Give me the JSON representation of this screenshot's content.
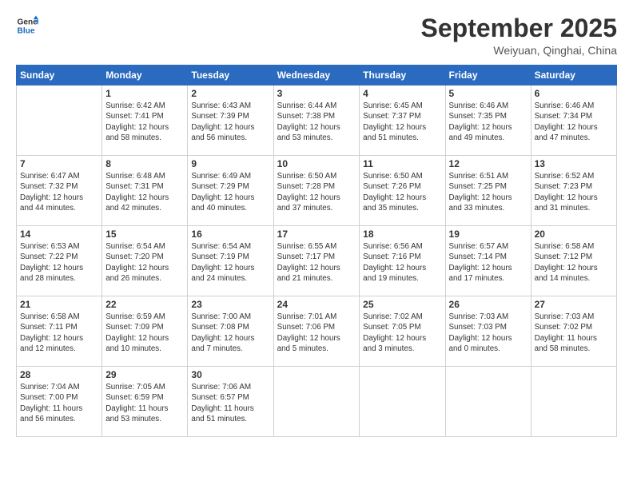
{
  "logo": {
    "line1": "General",
    "line2": "Blue"
  },
  "title": "September 2025",
  "location": "Weiyuan, Qinghai, China",
  "days_of_week": [
    "Sunday",
    "Monday",
    "Tuesday",
    "Wednesday",
    "Thursday",
    "Friday",
    "Saturday"
  ],
  "weeks": [
    [
      {
        "day": "",
        "info": ""
      },
      {
        "day": "1",
        "info": "Sunrise: 6:42 AM\nSunset: 7:41 PM\nDaylight: 12 hours\nand 58 minutes."
      },
      {
        "day": "2",
        "info": "Sunrise: 6:43 AM\nSunset: 7:39 PM\nDaylight: 12 hours\nand 56 minutes."
      },
      {
        "day": "3",
        "info": "Sunrise: 6:44 AM\nSunset: 7:38 PM\nDaylight: 12 hours\nand 53 minutes."
      },
      {
        "day": "4",
        "info": "Sunrise: 6:45 AM\nSunset: 7:37 PM\nDaylight: 12 hours\nand 51 minutes."
      },
      {
        "day": "5",
        "info": "Sunrise: 6:46 AM\nSunset: 7:35 PM\nDaylight: 12 hours\nand 49 minutes."
      },
      {
        "day": "6",
        "info": "Sunrise: 6:46 AM\nSunset: 7:34 PM\nDaylight: 12 hours\nand 47 minutes."
      }
    ],
    [
      {
        "day": "7",
        "info": "Sunrise: 6:47 AM\nSunset: 7:32 PM\nDaylight: 12 hours\nand 44 minutes."
      },
      {
        "day": "8",
        "info": "Sunrise: 6:48 AM\nSunset: 7:31 PM\nDaylight: 12 hours\nand 42 minutes."
      },
      {
        "day": "9",
        "info": "Sunrise: 6:49 AM\nSunset: 7:29 PM\nDaylight: 12 hours\nand 40 minutes."
      },
      {
        "day": "10",
        "info": "Sunrise: 6:50 AM\nSunset: 7:28 PM\nDaylight: 12 hours\nand 37 minutes."
      },
      {
        "day": "11",
        "info": "Sunrise: 6:50 AM\nSunset: 7:26 PM\nDaylight: 12 hours\nand 35 minutes."
      },
      {
        "day": "12",
        "info": "Sunrise: 6:51 AM\nSunset: 7:25 PM\nDaylight: 12 hours\nand 33 minutes."
      },
      {
        "day": "13",
        "info": "Sunrise: 6:52 AM\nSunset: 7:23 PM\nDaylight: 12 hours\nand 31 minutes."
      }
    ],
    [
      {
        "day": "14",
        "info": "Sunrise: 6:53 AM\nSunset: 7:22 PM\nDaylight: 12 hours\nand 28 minutes."
      },
      {
        "day": "15",
        "info": "Sunrise: 6:54 AM\nSunset: 7:20 PM\nDaylight: 12 hours\nand 26 minutes."
      },
      {
        "day": "16",
        "info": "Sunrise: 6:54 AM\nSunset: 7:19 PM\nDaylight: 12 hours\nand 24 minutes."
      },
      {
        "day": "17",
        "info": "Sunrise: 6:55 AM\nSunset: 7:17 PM\nDaylight: 12 hours\nand 21 minutes."
      },
      {
        "day": "18",
        "info": "Sunrise: 6:56 AM\nSunset: 7:16 PM\nDaylight: 12 hours\nand 19 minutes."
      },
      {
        "day": "19",
        "info": "Sunrise: 6:57 AM\nSunset: 7:14 PM\nDaylight: 12 hours\nand 17 minutes."
      },
      {
        "day": "20",
        "info": "Sunrise: 6:58 AM\nSunset: 7:12 PM\nDaylight: 12 hours\nand 14 minutes."
      }
    ],
    [
      {
        "day": "21",
        "info": "Sunrise: 6:58 AM\nSunset: 7:11 PM\nDaylight: 12 hours\nand 12 minutes."
      },
      {
        "day": "22",
        "info": "Sunrise: 6:59 AM\nSunset: 7:09 PM\nDaylight: 12 hours\nand 10 minutes."
      },
      {
        "day": "23",
        "info": "Sunrise: 7:00 AM\nSunset: 7:08 PM\nDaylight: 12 hours\nand 7 minutes."
      },
      {
        "day": "24",
        "info": "Sunrise: 7:01 AM\nSunset: 7:06 PM\nDaylight: 12 hours\nand 5 minutes."
      },
      {
        "day": "25",
        "info": "Sunrise: 7:02 AM\nSunset: 7:05 PM\nDaylight: 12 hours\nand 3 minutes."
      },
      {
        "day": "26",
        "info": "Sunrise: 7:03 AM\nSunset: 7:03 PM\nDaylight: 12 hours\nand 0 minutes."
      },
      {
        "day": "27",
        "info": "Sunrise: 7:03 AM\nSunset: 7:02 PM\nDaylight: 11 hours\nand 58 minutes."
      }
    ],
    [
      {
        "day": "28",
        "info": "Sunrise: 7:04 AM\nSunset: 7:00 PM\nDaylight: 11 hours\nand 56 minutes."
      },
      {
        "day": "29",
        "info": "Sunrise: 7:05 AM\nSunset: 6:59 PM\nDaylight: 11 hours\nand 53 minutes."
      },
      {
        "day": "30",
        "info": "Sunrise: 7:06 AM\nSunset: 6:57 PM\nDaylight: 11 hours\nand 51 minutes."
      },
      {
        "day": "",
        "info": ""
      },
      {
        "day": "",
        "info": ""
      },
      {
        "day": "",
        "info": ""
      },
      {
        "day": "",
        "info": ""
      }
    ]
  ]
}
